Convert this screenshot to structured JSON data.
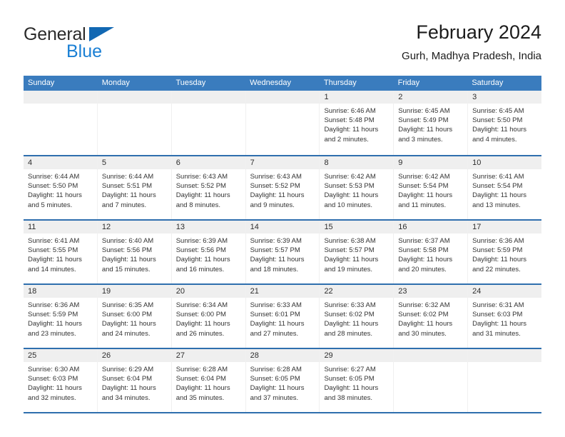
{
  "brand": {
    "name_part1": "General",
    "name_part2": "Blue",
    "triangle_color": "#1268b3",
    "blue_color": "#1a7fd4"
  },
  "header": {
    "title": "February 2024",
    "location": "Gurh, Madhya Pradesh, India"
  },
  "theme": {
    "header_blue": "#3a7cbe",
    "rule_blue": "#2f6fae",
    "day_band_gray": "#efefef"
  },
  "weekdays": [
    "Sunday",
    "Monday",
    "Tuesday",
    "Wednesday",
    "Thursday",
    "Friday",
    "Saturday"
  ],
  "weeks": [
    [
      {
        "day": "",
        "lines": []
      },
      {
        "day": "",
        "lines": []
      },
      {
        "day": "",
        "lines": []
      },
      {
        "day": "",
        "lines": []
      },
      {
        "day": "1",
        "lines": [
          "Sunrise: 6:46 AM",
          "Sunset: 5:48 PM",
          "Daylight: 11 hours",
          "and 2 minutes."
        ]
      },
      {
        "day": "2",
        "lines": [
          "Sunrise: 6:45 AM",
          "Sunset: 5:49 PM",
          "Daylight: 11 hours",
          "and 3 minutes."
        ]
      },
      {
        "day": "3",
        "lines": [
          "Sunrise: 6:45 AM",
          "Sunset: 5:50 PM",
          "Daylight: 11 hours",
          "and 4 minutes."
        ]
      }
    ],
    [
      {
        "day": "4",
        "lines": [
          "Sunrise: 6:44 AM",
          "Sunset: 5:50 PM",
          "Daylight: 11 hours",
          "and 5 minutes."
        ]
      },
      {
        "day": "5",
        "lines": [
          "Sunrise: 6:44 AM",
          "Sunset: 5:51 PM",
          "Daylight: 11 hours",
          "and 7 minutes."
        ]
      },
      {
        "day": "6",
        "lines": [
          "Sunrise: 6:43 AM",
          "Sunset: 5:52 PM",
          "Daylight: 11 hours",
          "and 8 minutes."
        ]
      },
      {
        "day": "7",
        "lines": [
          "Sunrise: 6:43 AM",
          "Sunset: 5:52 PM",
          "Daylight: 11 hours",
          "and 9 minutes."
        ]
      },
      {
        "day": "8",
        "lines": [
          "Sunrise: 6:42 AM",
          "Sunset: 5:53 PM",
          "Daylight: 11 hours",
          "and 10 minutes."
        ]
      },
      {
        "day": "9",
        "lines": [
          "Sunrise: 6:42 AM",
          "Sunset: 5:54 PM",
          "Daylight: 11 hours",
          "and 11 minutes."
        ]
      },
      {
        "day": "10",
        "lines": [
          "Sunrise: 6:41 AM",
          "Sunset: 5:54 PM",
          "Daylight: 11 hours",
          "and 13 minutes."
        ]
      }
    ],
    [
      {
        "day": "11",
        "lines": [
          "Sunrise: 6:41 AM",
          "Sunset: 5:55 PM",
          "Daylight: 11 hours",
          "and 14 minutes."
        ]
      },
      {
        "day": "12",
        "lines": [
          "Sunrise: 6:40 AM",
          "Sunset: 5:56 PM",
          "Daylight: 11 hours",
          "and 15 minutes."
        ]
      },
      {
        "day": "13",
        "lines": [
          "Sunrise: 6:39 AM",
          "Sunset: 5:56 PM",
          "Daylight: 11 hours",
          "and 16 minutes."
        ]
      },
      {
        "day": "14",
        "lines": [
          "Sunrise: 6:39 AM",
          "Sunset: 5:57 PM",
          "Daylight: 11 hours",
          "and 18 minutes."
        ]
      },
      {
        "day": "15",
        "lines": [
          "Sunrise: 6:38 AM",
          "Sunset: 5:57 PM",
          "Daylight: 11 hours",
          "and 19 minutes."
        ]
      },
      {
        "day": "16",
        "lines": [
          "Sunrise: 6:37 AM",
          "Sunset: 5:58 PM",
          "Daylight: 11 hours",
          "and 20 minutes."
        ]
      },
      {
        "day": "17",
        "lines": [
          "Sunrise: 6:36 AM",
          "Sunset: 5:59 PM",
          "Daylight: 11 hours",
          "and 22 minutes."
        ]
      }
    ],
    [
      {
        "day": "18",
        "lines": [
          "Sunrise: 6:36 AM",
          "Sunset: 5:59 PM",
          "Daylight: 11 hours",
          "and 23 minutes."
        ]
      },
      {
        "day": "19",
        "lines": [
          "Sunrise: 6:35 AM",
          "Sunset: 6:00 PM",
          "Daylight: 11 hours",
          "and 24 minutes."
        ]
      },
      {
        "day": "20",
        "lines": [
          "Sunrise: 6:34 AM",
          "Sunset: 6:00 PM",
          "Daylight: 11 hours",
          "and 26 minutes."
        ]
      },
      {
        "day": "21",
        "lines": [
          "Sunrise: 6:33 AM",
          "Sunset: 6:01 PM",
          "Daylight: 11 hours",
          "and 27 minutes."
        ]
      },
      {
        "day": "22",
        "lines": [
          "Sunrise: 6:33 AM",
          "Sunset: 6:02 PM",
          "Daylight: 11 hours",
          "and 28 minutes."
        ]
      },
      {
        "day": "23",
        "lines": [
          "Sunrise: 6:32 AM",
          "Sunset: 6:02 PM",
          "Daylight: 11 hours",
          "and 30 minutes."
        ]
      },
      {
        "day": "24",
        "lines": [
          "Sunrise: 6:31 AM",
          "Sunset: 6:03 PM",
          "Daylight: 11 hours",
          "and 31 minutes."
        ]
      }
    ],
    [
      {
        "day": "25",
        "lines": [
          "Sunrise: 6:30 AM",
          "Sunset: 6:03 PM",
          "Daylight: 11 hours",
          "and 32 minutes."
        ]
      },
      {
        "day": "26",
        "lines": [
          "Sunrise: 6:29 AM",
          "Sunset: 6:04 PM",
          "Daylight: 11 hours",
          "and 34 minutes."
        ]
      },
      {
        "day": "27",
        "lines": [
          "Sunrise: 6:28 AM",
          "Sunset: 6:04 PM",
          "Daylight: 11 hours",
          "and 35 minutes."
        ]
      },
      {
        "day": "28",
        "lines": [
          "Sunrise: 6:28 AM",
          "Sunset: 6:05 PM",
          "Daylight: 11 hours",
          "and 37 minutes."
        ]
      },
      {
        "day": "29",
        "lines": [
          "Sunrise: 6:27 AM",
          "Sunset: 6:05 PM",
          "Daylight: 11 hours",
          "and 38 minutes."
        ]
      },
      {
        "day": "",
        "lines": []
      },
      {
        "day": "",
        "lines": []
      }
    ]
  ]
}
